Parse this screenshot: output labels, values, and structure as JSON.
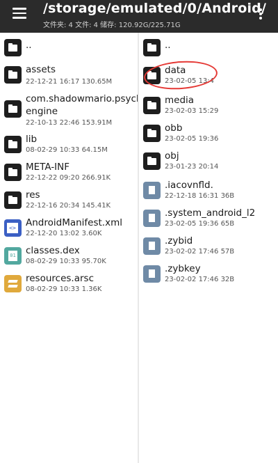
{
  "header": {
    "title": "/storage/emulated/0/Android/",
    "subtitle": "文件夹: 4  文件: 4  储存: 120.92G/225.71G"
  },
  "left_pane": {
    "items": [
      {
        "name": "..",
        "meta": "",
        "type": "folder"
      },
      {
        "name": "assets",
        "meta": "22-12-21 16:17  130.65M",
        "type": "folder"
      },
      {
        "name": "com.shadowmario.psych",
        "name2": "engine",
        "meta": "22-10-13 22:46  153.91M",
        "type": "folder"
      },
      {
        "name": "lib",
        "meta": "08-02-29 10:33  64.15M",
        "type": "folder"
      },
      {
        "name": "META-INF",
        "meta": "22-12-22 09:20  266.91K",
        "type": "folder"
      },
      {
        "name": "res",
        "meta": "22-12-16 20:34  145.41K",
        "type": "folder"
      },
      {
        "name": "AndroidManifest.xml",
        "meta": "22-12-20 13:02  3.60K",
        "type": "xml-file"
      },
      {
        "name": "classes.dex",
        "meta": "08-02-29 10:33  95.70K",
        "type": "dex-file"
      },
      {
        "name": "resources.arsc",
        "meta": "08-02-29 10:33  1.36K",
        "type": "arsc-file"
      }
    ]
  },
  "right_pane": {
    "items": [
      {
        "name": "..",
        "meta": "",
        "type": "folder"
      },
      {
        "name": "data",
        "meta": "23-02-05 13:4",
        "type": "folder"
      },
      {
        "name": "media",
        "meta": "23-02-03 15:29",
        "type": "folder"
      },
      {
        "name": "obb",
        "meta": "23-02-05 19:36",
        "type": "folder"
      },
      {
        "name": "obj",
        "meta": "23-01-23 20:14",
        "type": "folder"
      },
      {
        "name": ".iacovnfld.",
        "meta": "22-12-18 16:31  36B",
        "type": "file"
      },
      {
        "name": ".system_android_l2",
        "meta": "23-02-05 19:36  65B",
        "type": "file"
      },
      {
        "name": ".zybid",
        "meta": "23-02-02 17:46  57B",
        "type": "file"
      },
      {
        "name": ".zybkey",
        "meta": "23-02-02 17:46  32B",
        "type": "file"
      }
    ]
  },
  "annotation": {
    "color": "#e53935"
  },
  "colors": {
    "topbar": "#2b2b2b",
    "folder": "#1e1e1e",
    "file": "#6f8aa6",
    "xml": "#3b5fc4",
    "dex": "#52a89f",
    "arsc": "#e0a93c"
  }
}
